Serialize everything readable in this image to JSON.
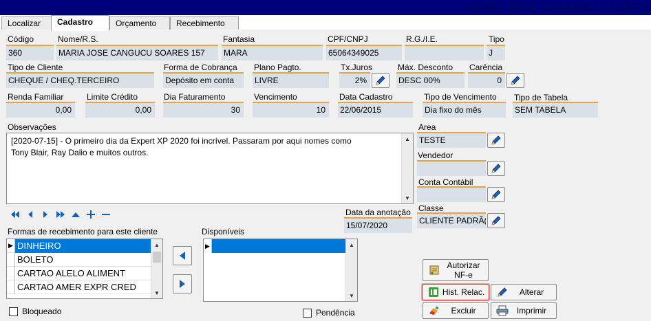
{
  "window": {
    "client_name": "MARIA JOSE CANGUCU SOARE"
  },
  "tabs": [
    {
      "label": "Localizar"
    },
    {
      "label": "Cadastro"
    },
    {
      "label": "Orçamento"
    },
    {
      "label": "Recebimento"
    }
  ],
  "fields": {
    "codigo": {
      "label": "Código",
      "value": "360"
    },
    "nome": {
      "label": "Nome/R.S.",
      "value": "MARIA JOSE CANGUCU SOARES 157"
    },
    "fantasia": {
      "label": "Fantasia",
      "value": "MARA"
    },
    "cpf": {
      "label": "CPF/CNPJ",
      "value": "65064349025"
    },
    "rg": {
      "label": "R.G./I.E.",
      "value": ""
    },
    "tipo": {
      "label": "Tipo",
      "value": "J"
    },
    "tipo_cliente": {
      "label": "Tipo de Cliente",
      "value": "CHEQUE / CHEQ.TERCEIRO"
    },
    "forma_cobranca": {
      "label": "Forma de Cobrança",
      "value": "Depósito em conta"
    },
    "plano_pagto": {
      "label": "Plano Pagto.",
      "value": "LIVRE"
    },
    "tx_juros": {
      "label": "Tx.Juros",
      "value": "2%"
    },
    "max_desconto": {
      "label": "Máx. Desconto",
      "value": "DESC 00%"
    },
    "carencia": {
      "label": "Carência",
      "value": "0"
    },
    "renda_familiar": {
      "label": "Renda Familiar",
      "value": "0,00"
    },
    "limite_credito": {
      "label": "Limite Crédito",
      "value": "0,00"
    },
    "dia_faturamento": {
      "label": "Dia Faturamento",
      "value": "30"
    },
    "vencimento": {
      "label": "Vencimento",
      "value": "10"
    },
    "data_cadastro": {
      "label": "Data Cadastro",
      "value": "22/06/2015"
    },
    "tipo_vencimento": {
      "label": "Tipo de Vencimento",
      "value": "Dia fixo do mês"
    },
    "tipo_tabela": {
      "label": "Tipo de Tabela",
      "value": "SEM TABELA"
    },
    "area": {
      "label": "Area",
      "value": "TESTE"
    },
    "vendedor": {
      "label": "Vendedor",
      "value": ""
    },
    "conta_contabil": {
      "label": "Conta Contábil",
      "value": ""
    },
    "classe": {
      "label": "Classe",
      "value": "CLIENTE PADRÃ("
    },
    "data_anotacao": {
      "label": "Data da anotação",
      "value": "15/07/2020"
    }
  },
  "observacoes": {
    "label": "Observações",
    "text": "[2020-07-15] - O primeiro dia da Expert XP 2020 foi incrível. Passaram por aqui nomes como\nTony Blair, Ray Dalio e muitos outros."
  },
  "formas": {
    "label": "Formas de recebimento para este cliente",
    "items": [
      "DINHEIRO",
      "BOLETO",
      "CARTAO ALELO ALIMENT",
      "CARTAO AMER EXPR CRED"
    ]
  },
  "disponiveis": {
    "label": "Disponíveis"
  },
  "checks": {
    "bloqueado": "Bloqueado",
    "pendencia": "Pendência"
  },
  "buttons": {
    "autorizar_line1": "Autorizar",
    "autorizar_line2": "NF-e",
    "hist": "Hist. Relac.",
    "alterar": "Alterar",
    "excluir": "Excluir",
    "imprimir": "Imprimir"
  },
  "colors": {
    "title_bar": "#00007c",
    "field_bg": "#d9e0e8",
    "field_accent": "#f0a040",
    "selection": "#0078d7",
    "nav_icon": "#1a5fb4",
    "hist_border": "#d03030"
  }
}
